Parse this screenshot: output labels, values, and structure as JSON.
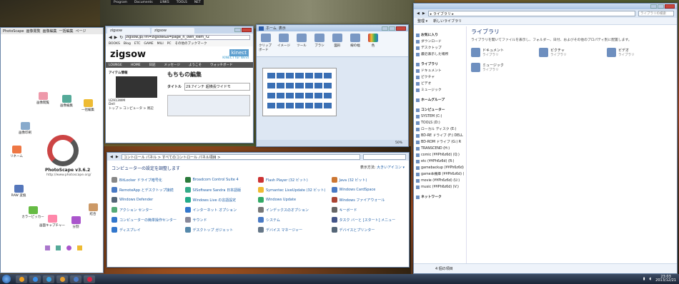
{
  "topbar": {
    "items": [
      "Program",
      "Documents",
      "LINKS",
      "TOOLS",
      "NET"
    ]
  },
  "photoscape": {
    "title": "PhotoScape",
    "tabs": [
      "画像閲覧",
      "画像編集",
      "一括編集",
      "ページ"
    ],
    "icons": [
      "画像閲覧",
      "画像編集",
      "一括編集",
      "画像印刷",
      "結合",
      "スライド",
      "分割",
      "GIFアニメ",
      "画面キャプチャー",
      "カラーピッカー",
      "RAW 変換",
      "リネーム"
    ],
    "version": "PhotoScape v3.6.2",
    "url": "http://www.photoscape.org/"
  },
  "browser": {
    "tabs": [
      "zigsow",
      "zigsow"
    ],
    "url": "zigsow.jp/?m=zigsow&a=page_h_own_item_r2",
    "bookmarks": [
      "BOOKS",
      "Blog",
      "ETC",
      "GAME",
      "MILI",
      "PC",
      "その他のブックマーク"
    ],
    "logo": "zigsow",
    "banner": "kinect",
    "banner_sub": "KINECT for Wind",
    "nav": [
      "LOUNGE",
      "HOME",
      "日記",
      "メッセージ",
      "ようこそ",
      "ウォッチボード"
    ],
    "side_title": "アイテム情報",
    "model": "U2913WM",
    "maker": "Dell",
    "cat": "トップ > コンピュータ > 周辺",
    "heading": "もちもの編集",
    "title_label": "タイトル",
    "title_value": "29.7インチ 超横長ワイドモ"
  },
  "paint": {
    "tabs": [
      "ホーム",
      "表示"
    ],
    "tools": [
      "クリップボード",
      "イメージ",
      "ツール",
      "ブラシ",
      "図形",
      "線の幅",
      "色"
    ],
    "zoom": "50%"
  },
  "cp": {
    "path": "コントロール パネル > すべてのコントロール パネル項目 >",
    "heading": "コンピューターの設定を調整します",
    "view_label": "表示方法:",
    "view_value": "大きいアイコン ▾",
    "items": [
      {
        "label": "BitLocker ドライブ暗号化",
        "color": "#888"
      },
      {
        "label": "Broadcom Control Suite 4",
        "color": "#2a7a3a"
      },
      {
        "label": "Flash Player (32 ビット)",
        "color": "#c33"
      },
      {
        "label": "Java (32 ビット)",
        "color": "#c73"
      },
      {
        "label": "RemoteApp とデスクトップ接続",
        "color": "#4a7ac4"
      },
      {
        "label": "SISoftware Sandra 日本語版",
        "color": "#3a8"
      },
      {
        "label": "Symantec LiveUpdate (32 ビット)",
        "color": "#eb3"
      },
      {
        "label": "Windows CardSpace",
        "color": "#4a7ac4"
      },
      {
        "label": "Windows Defender",
        "color": "#567"
      },
      {
        "label": "Windows Live の言語設定",
        "color": "#2a8"
      },
      {
        "label": "Windows Update",
        "color": "#3a6"
      },
      {
        "label": "Windows ファイアウォール",
        "color": "#a43"
      },
      {
        "label": "アクション センター",
        "color": "#5a7"
      },
      {
        "label": "インターネット オプション",
        "color": "#37c"
      },
      {
        "label": "インデックスのオプション",
        "color": "#777"
      },
      {
        "label": "キーボード",
        "color": "#666"
      },
      {
        "label": "コンピューターの簡単操作センター",
        "color": "#37c"
      },
      {
        "label": "サウンド",
        "color": "#889"
      },
      {
        "label": "システム",
        "color": "#4a7ac4"
      },
      {
        "label": "タスク バーと [スタート] メニュー",
        "color": "#458"
      },
      {
        "label": "ディスプレイ",
        "color": "#37c"
      },
      {
        "label": "デスクトップ ガジェット",
        "color": "#58a"
      },
      {
        "label": "デバイス マネージャー",
        "color": "#678"
      },
      {
        "label": "デバイスとプリンター",
        "color": "#567"
      }
    ]
  },
  "explorer": {
    "path": "▸ ライブラリ ▸",
    "search": "ライブラリの検索",
    "commands": [
      "整理 ▾",
      "新しいライブラリ"
    ],
    "nav": [
      {
        "label": "お気に入り",
        "sec": true
      },
      {
        "label": "ダウンロード"
      },
      {
        "label": "デスクトップ"
      },
      {
        "label": "最近表示した場所"
      },
      {
        "label": "ライブラリ",
        "sec": true
      },
      {
        "label": "ドキュメント"
      },
      {
        "label": "ピクチャ"
      },
      {
        "label": "ビデオ"
      },
      {
        "label": "ミュージック"
      },
      {
        "label": "ホームグループ",
        "sec": true
      },
      {
        "label": "コンピューター",
        "sec": true
      },
      {
        "label": "SYSTEM (C:)"
      },
      {
        "label": "TOOLS (D:)"
      },
      {
        "label": "ローカル ディスク (E:)"
      },
      {
        "label": "BD-RE ドライブ (F:) DELL"
      },
      {
        "label": "BD-ROM ドライブ (G:) R"
      },
      {
        "label": "TRANSCEND (H:)"
      },
      {
        "label": "comic (¥¥Ph6z6d) (Q:)"
      },
      {
        "label": "etc (¥¥Ph6z6d) (R:)"
      },
      {
        "label": "gamebackup (¥¥Ph6z6d) (S)"
      },
      {
        "label": "game本棚庫 (¥¥Ph6z6d) (T)"
      },
      {
        "label": "movie (¥¥Ph6z6d) (U:)"
      },
      {
        "label": "music (¥¥Ph6z6d) (V:)"
      },
      {
        "label": "ネットワーク",
        "sec": true
      }
    ],
    "heading": "ライブラリ",
    "subtitle": "ライブラリを開いてファイルを表示し、フォルダー、日付、およびその他のプロパティ別に配置します。",
    "libs": [
      {
        "name": "ドキュメント",
        "type": "ライブラリ"
      },
      {
        "name": "ピクチャ",
        "type": "ライブラリ"
      },
      {
        "name": "ビデオ",
        "type": "ライブラリ"
      },
      {
        "name": "ミュージック",
        "type": "ライブラリ"
      }
    ],
    "status": "4 個の項目"
  },
  "taskbar": {
    "time": "23:03",
    "date": "2013/12/21",
    "apps": [
      "#f0a020",
      "#3a8ee8",
      "#3aa0e0",
      "#e8a030",
      "#4a7ac4",
      "#d24"
    ]
  }
}
